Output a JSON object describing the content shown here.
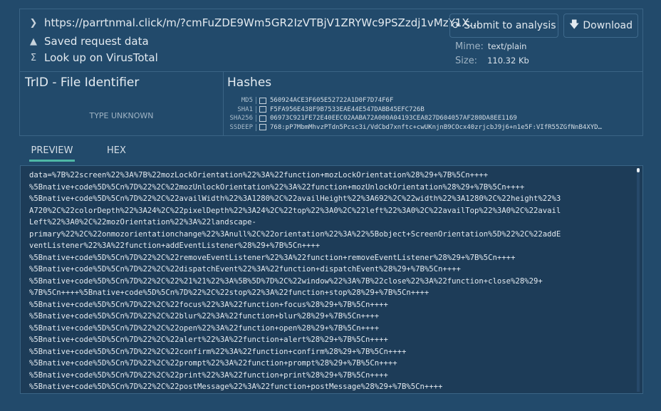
{
  "header": {
    "url": "https://parrtnmal.click/m/?cmFuZDE9Wm5GR2IzVTBjV1ZRYWc9PSZzdj1vMzY1X...",
    "saved": "Saved request data",
    "virustotal": "Look up on VirusTotal",
    "submit": "Submit to analysis",
    "download": "Download",
    "mime_label": "Mime:",
    "mime": "text/plain",
    "size_label": "Size:",
    "size": "110.32 Kb"
  },
  "trid": {
    "title": "TrID - File Identifier",
    "type": "TYPE UNKNOWN"
  },
  "hashes": {
    "title": "Hashes",
    "items": [
      {
        "label": "MD5",
        "value": "560924ACE3F605E52722A1D0F7D74F6F"
      },
      {
        "label": "SHA1",
        "value": "F5FA956E438F9B7533EAE44E547DABB45EFC726B"
      },
      {
        "label": "SHA256",
        "value": "06973C921FE72E40EEC02AABA72A000A04193CEA827D604057AF280DA8EE1169"
      },
      {
        "label": "SSDEEP",
        "value": "768:pP7MbmMhvzPTdn5Pcsc3i/VdCbd7xnftc+cwUKnjnB9COcx40zrjcbJ9j6+n1e5F:VIfR55ZGfNnB4XYD…"
      }
    ]
  },
  "tabs": [
    "PREVIEW",
    "HEX"
  ],
  "preview": [
    "data=%7B%22screen%22%3A%7B%22mozLockOrientation%22%3A%22function+mozLockOrientation%28%29+%7B%5Cn++++",
    "%5Bnative+code%5D%5Cn%7D%22%2C%22mozUnlockOrientation%22%3A%22function+mozUnlockOrientation%28%29+%7B%5Cn++++",
    "%5Bnative+code%5D%5Cn%7D%22%2C%22availWidth%22%3A1280%2C%22availHeight%22%3A692%2C%22width%22%3A1280%2C%22height%22%3",
    "A720%2C%22colorDepth%22%3A24%2C%22pixelDepth%22%3A24%2C%22top%22%3A0%2C%22left%22%3A0%2C%22availTop%22%3A0%2C%22avail",
    "Left%22%3A0%2C%22mozOrientation%22%3A%22landscape-",
    "primary%22%2C%22onmozorientationchange%22%3Anull%2C%22orientation%22%3A%22%5Bobject+ScreenOrientation%5D%22%2C%22addE",
    "ventListener%22%3A%22function+addEventListener%28%29+%7B%5Cn++++",
    "%5Bnative+code%5D%5Cn%7D%22%2C%22removeEventListener%22%3A%22function+removeEventListener%28%29+%7B%5Cn++++",
    "%5Bnative+code%5D%5Cn%7D%22%2C%22dispatchEvent%22%3A%22function+dispatchEvent%28%29+%7B%5Cn++++",
    "%5Bnative+code%5D%5Cn%7D%22%2C%22%21%21%22%3A%5B%5D%7D%2C%22window%22%3A%7B%22close%22%3A%22function+close%28%29+",
    "%7B%5Cn++++%5Bnative+code%5D%5Cn%7D%22%2C%22stop%22%3A%22function+stop%28%29+%7B%5Cn++++",
    "%5Bnative+code%5D%5Cn%7D%22%2C%22focus%22%3A%22function+focus%28%29+%7B%5Cn++++",
    "%5Bnative+code%5D%5Cn%7D%22%2C%22blur%22%3A%22function+blur%28%29+%7B%5Cn++++",
    "%5Bnative+code%5D%5Cn%7D%22%2C%22open%22%3A%22function+open%28%29+%7B%5Cn++++",
    "%5Bnative+code%5D%5Cn%7D%22%2C%22alert%22%3A%22function+alert%28%29+%7B%5Cn++++",
    "%5Bnative+code%5D%5Cn%7D%22%2C%22confirm%22%3A%22function+confirm%28%29+%7B%5Cn++++",
    "%5Bnative+code%5D%5Cn%7D%22%2C%22prompt%22%3A%22function+prompt%28%29+%7B%5Cn++++",
    "%5Bnative+code%5D%5Cn%7D%22%2C%22print%22%3A%22function+print%28%29+%7B%5Cn++++",
    "%5Bnative+code%5D%5Cn%7D%22%2C%22postMessage%22%3A%22function+postMessage%28%29+%7B%5Cn++++"
  ]
}
